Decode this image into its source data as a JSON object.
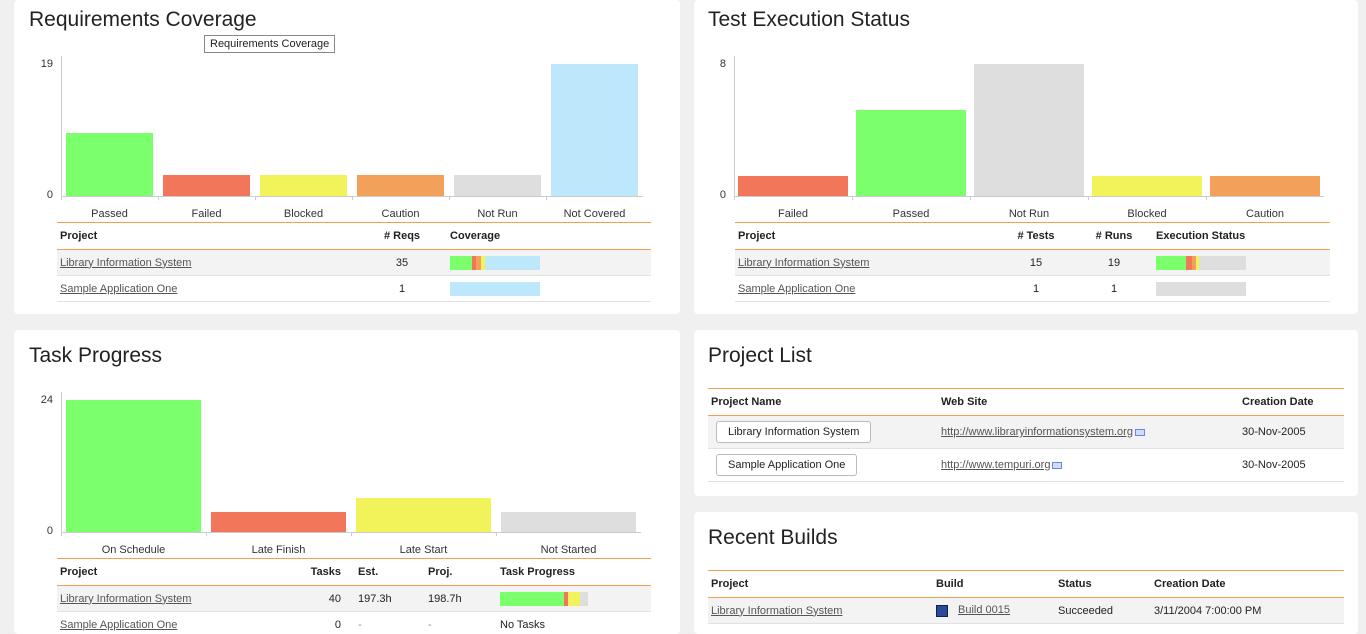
{
  "colors": {
    "passed": "#7cff6c",
    "failed": "#f2765a",
    "blocked": "#f2f25a",
    "caution": "#f2a05a",
    "notrun": "#dedede",
    "notcovered": "#bde8fb"
  },
  "req_coverage": {
    "title": "Requirements Coverage",
    "tooltip": "Requirements Coverage",
    "chart_data": {
      "type": "bar",
      "categories": [
        "Passed",
        "Failed",
        "Blocked",
        "Caution",
        "Not Run",
        "Not Covered"
      ],
      "values": [
        9,
        3,
        3,
        3,
        3,
        19
      ],
      "ylim": [
        0,
        19
      ],
      "yticks": [
        "19",
        "0"
      ]
    },
    "table": {
      "headers": [
        "Project",
        "# Reqs",
        "Coverage"
      ],
      "rows": [
        {
          "project": "Library Information System",
          "reqs": "35"
        },
        {
          "project": "Sample Application One",
          "reqs": "1"
        }
      ]
    }
  },
  "test_execution": {
    "title": "Test Execution Status",
    "chart_data": {
      "type": "bar",
      "categories": [
        "Failed",
        "Passed",
        "Not Run",
        "Blocked",
        "Caution"
      ],
      "values": [
        1.2,
        5.2,
        8,
        1.2,
        1.2
      ],
      "ylim": [
        0,
        8
      ],
      "yticks": [
        "8",
        "0"
      ]
    },
    "table": {
      "headers": [
        "Project",
        "# Tests",
        "# Runs",
        "Execution Status"
      ],
      "rows": [
        {
          "project": "Library Information System",
          "tests": "15",
          "runs": "19"
        },
        {
          "project": "Sample Application One",
          "tests": "1",
          "runs": "1"
        }
      ]
    }
  },
  "task_progress": {
    "title": "Task Progress",
    "chart_data": {
      "type": "bar",
      "categories": [
        "On Schedule",
        "Late Finish",
        "Late Start",
        "Not Started"
      ],
      "values": [
        24,
        3.6,
        6.2,
        3.6
      ],
      "ylim": [
        0,
        24
      ],
      "yticks": [
        "24",
        "0"
      ]
    },
    "table": {
      "headers": [
        "Project",
        "Tasks",
        "Est.",
        "Proj.",
        "Task Progress"
      ],
      "rows": [
        {
          "project": "Library Information System",
          "tasks": "40",
          "est": "197.3h",
          "proj": "198.7h",
          "progress": ""
        },
        {
          "project": "Sample Application One",
          "tasks": "0",
          "est": "-",
          "proj": "-",
          "progress": "No Tasks"
        }
      ]
    }
  },
  "project_list": {
    "title": "Project List",
    "headers": [
      "Project Name",
      "Web Site",
      "Creation Date"
    ],
    "rows": [
      {
        "name": "Library Information System",
        "site": "http://www.libraryinformationsystem.org",
        "date": "30-Nov-2005"
      },
      {
        "name": "Sample Application One",
        "site": "http://www.tempuri.org",
        "date": "30-Nov-2005"
      }
    ]
  },
  "recent_builds": {
    "title": "Recent Builds",
    "headers": [
      "Project",
      "Build",
      "Status",
      "Creation Date"
    ],
    "rows": [
      {
        "project": "Library Information System",
        "build": "Build 0015",
        "status": "Succeeded",
        "date": "3/11/2004 7:00:00 PM"
      }
    ]
  }
}
